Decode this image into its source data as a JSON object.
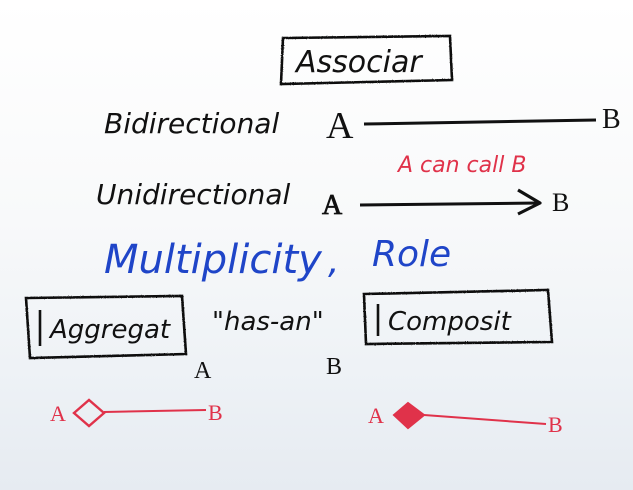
{
  "title": "Associar",
  "rows": {
    "bidirectional": {
      "label": "Bidirectional",
      "from": "A",
      "to": "B"
    },
    "unidirectional": {
      "label": "Unidirectional",
      "from": "A",
      "to": "B",
      "note": "A can call B"
    }
  },
  "concepts": {
    "multiplicity": "Multiplicity",
    "separator": ",",
    "role": "Role"
  },
  "relations": {
    "aggregation": {
      "box_label": "Aggregat",
      "has_a": "\"has-an\"",
      "from": "A",
      "to": "B"
    },
    "composition": {
      "box_label": "Composit",
      "from": "A",
      "to": "B"
    }
  },
  "colors": {
    "ink": "#111111",
    "blue": "#1f45c8",
    "red": "#e0324a"
  }
}
